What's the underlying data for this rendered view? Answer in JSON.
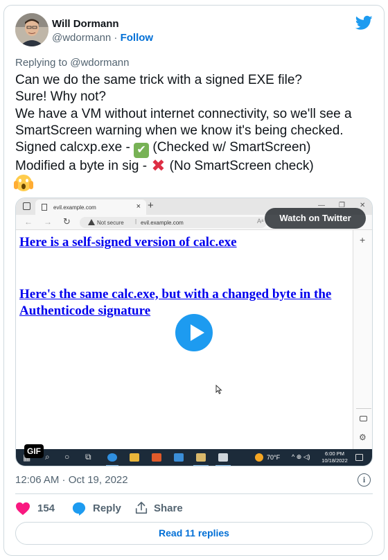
{
  "author": {
    "name": "Will Dormann",
    "handle": "@wdormann",
    "separator": " · ",
    "follow_label": "Follow"
  },
  "replying_to": "Replying to @wdormann",
  "tweet_lines": [
    "Can we do the same trick with a signed EXE file?",
    "Sure! Why not?",
    "We have a VM without internet connectivity, so we'll see a",
    "SmartScreen warning when we know it's being checked.",
    "Signed calcxp.exe - ",
    " (Checked w/ SmartScreen)",
    "Modified a byte in sig - ",
    " (No SmartScreen check)"
  ],
  "emoji": {
    "check": "✔",
    "cross": "✖"
  },
  "media": {
    "tab_title": "evil.example.com",
    "tab_close": "×",
    "new_tab": "+",
    "not_secure": "Not secure",
    "url_separator": "|",
    "url": "evil.example.com",
    "read_aloud": "Aᵃ",
    "link1": "Here is a self-signed version of calc.exe",
    "link2": "Here's the same calc.exe, but with a changed byte in the Authenticode signature",
    "watch_label": "Watch on Twitter",
    "gif_label": "GIF",
    "taskbar": {
      "temp": "70°F",
      "tray": "^ ⊕ ◁)",
      "time": "6:00 PM",
      "date": "10/18/2022"
    }
  },
  "timestamp": "12:06 AM · Oct 19, 2022",
  "info_glyph": "i",
  "actions": {
    "like_count": "154",
    "reply_label": "Reply",
    "share_label": "Share"
  },
  "read_replies": "Read 11 replies",
  "colors": {
    "brand_blue": "#1d9bf0",
    "link_blue": "#006fd6",
    "heart_pink": "#f91880",
    "text_gray": "#536471"
  }
}
